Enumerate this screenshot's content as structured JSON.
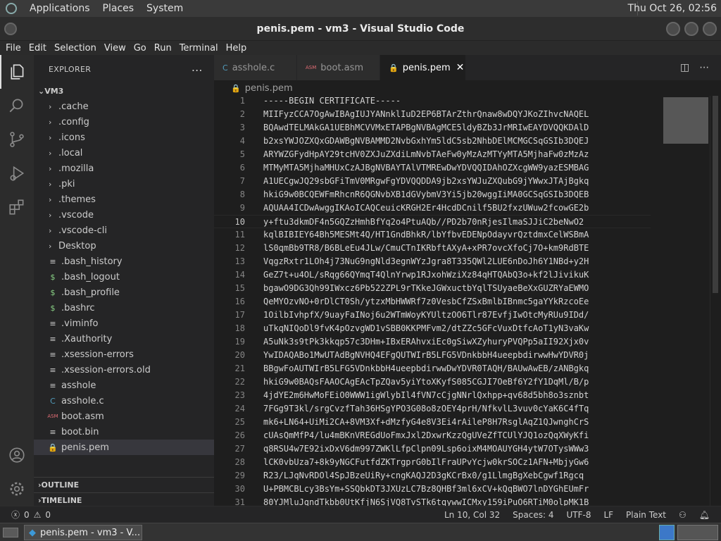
{
  "system_bar": {
    "menus": [
      "Applications",
      "Places",
      "System"
    ],
    "clock": "Thu Oct 26, 02:56"
  },
  "window": {
    "title": "penis.pem - vm3 - Visual Studio Code"
  },
  "menubar": [
    "File",
    "Edit",
    "Selection",
    "View",
    "Go",
    "Run",
    "Terminal",
    "Help"
  ],
  "activity_bar": {
    "top": [
      "explorer-icon",
      "search-icon",
      "source-control-icon",
      "run-debug-icon",
      "extensions-icon"
    ],
    "bottom": [
      "account-icon",
      "settings-gear-icon"
    ]
  },
  "explorer": {
    "title": "EXPLORER",
    "root": "VM3",
    "folders": [
      ".cache",
      ".config",
      ".icons",
      ".local",
      ".mozilla",
      ".pki",
      ".themes",
      ".vscode",
      ".vscode-cli",
      "Desktop"
    ],
    "files": [
      {
        "name": ".bash_history",
        "icon": "≡",
        "color": "#cccccc"
      },
      {
        "name": ".bash_logout",
        "icon": "$",
        "color": "#89d185"
      },
      {
        "name": ".bash_profile",
        "icon": "$",
        "color": "#89d185"
      },
      {
        "name": ".bashrc",
        "icon": "$",
        "color": "#89d185"
      },
      {
        "name": ".viminfo",
        "icon": "≡",
        "color": "#cccccc"
      },
      {
        "name": ".Xauthority",
        "icon": "≡",
        "color": "#cccccc"
      },
      {
        "name": ".xsession-errors",
        "icon": "≡",
        "color": "#cccccc"
      },
      {
        "name": ".xsession-errors.old",
        "icon": "≡",
        "color": "#cccccc"
      },
      {
        "name": "asshole",
        "icon": "≡",
        "color": "#cccccc"
      },
      {
        "name": "asshole.c",
        "icon": "C",
        "color": "#519aba"
      },
      {
        "name": "boot.asm",
        "icon": "ASM",
        "color": "#e06c75"
      },
      {
        "name": "boot.bin",
        "icon": "≡",
        "color": "#cccccc"
      },
      {
        "name": "penis.pem",
        "icon": "🔒",
        "color": "#e5c07b"
      }
    ],
    "selected": "penis.pem",
    "outline": "OUTLINE",
    "timeline": "TIMELINE"
  },
  "tabs": [
    {
      "label": "asshole.c",
      "icon": "C",
      "color": "#519aba",
      "active": false
    },
    {
      "label": "boot.asm",
      "icon": "ASM",
      "color": "#e06c75",
      "active": false
    },
    {
      "label": "penis.pem",
      "icon": "🔒",
      "color": "#e5c07b",
      "active": true
    }
  ],
  "breadcrumb": "penis.pem",
  "editor": {
    "current_line": 10,
    "lines": [
      "-----BEGIN CERTIFICATE-----",
      "MIIFyzCCA7OgAwIBAgIUJYANnklIuD2EP6BTArZthrQnaw8wDQYJKoZIhvcNAQEL",
      "BQAwdTELMAkGA1UEBhMCVVMxETAPBgNVBAgMCE5ldyBZb3JrMRIwEAYDVQQKDAlD",
      "b2xsYWJOZXQxGDAWBgNVBAMMD2NvbGxhYm5ldC5sb2NhbDElMCMGCSqGSIb3DQEJ",
      "ARYWZGFydHpAY29tcHV0ZXJuZXdiLmNvbTAeFw0yMzAzMTYyMTA5MjhaFw0zMzAz",
      "MTMyMTA5MjhaMHUxCzAJBgNVBAYTAlVTMREwDwYDVQQIDAhOZXcgWW9yazESMBAG",
      "A1UECgwJQ29sbGFiTmV0MRgwFgYDVQQDDA9jb2xsYWJuZXQubG9jYWwxJTAjBgkq",
      "hkiG9w0BCQEWFmRhcnR6QGNvbXB1dGVybmV3Yi5jb20wggIiMA0GCSqGSIb3DQEB",
      "AQUAA4ICDwAwggIKAoICAQCeuicKRGH2Er4HcdDCnilf5BU2fxzUWuw2fcowGE2b",
      "y+ftu3dkmDF4n5GQZzHmhBfYq2o4PtuAQb//PD2b70nRjesIlmaSJJiC2beNwO2",
      "kqlBIBIEY64Bh5MESMt4Q/HT1GndBhkR/lbYfbvEDENpOdayvrQztdmxCelWSBmA",
      "lS0qmBb9TR8/B6BLeEu4JLw/CmuCTnIKRbftAXyA+xPR7ovcXfoCj7O+km9RdBTE",
      "VqgzRxtr1LOh4j73NuG9ngNld3egnWYzJgra8T335QWl2LUE6nDoJh6Y1NBd+y2H",
      "GeZ7t+u4OL/sRqg66QYmqT4QlnYrwp1RJxohWziXz84qHTQAbQ3o+kf2lJivikuK",
      "bgawO9DG3Qh99IWxcz6Pb522ZPL9rTKkeJGWxuctbYqlTSUyaeBeXxGUZRYaEWMO",
      "QeMYOzvNO+0rDlCT0Sh/ytzxMbHWWRf7z0VesbCfZSxBmlbIBnmc5gaYYkRzcoEe",
      "1OilbIvhpfX/9uayFaINoj6u2WTmWoyKYUltzOO6Tlr87EvfjIwOtcMyRUu9IDd/",
      "uTkqNIQoDl9fvK4pOzvgWD1vSBB0KKPMFvm2/dtZZc5GFcVuxDtfcAoT1yN3vaKw",
      "A5uNk3s9tPk3kkqp57c3DHm+IBxERAhvxiEc0gSiwXZyhuryPVQPp5aII92Xjx0v",
      "YwIDAQABo1MwUTAdBgNVHQ4EFgQUTWIrB5LFG5VDnkbbH4ueepbdirwwHwYDVR0j",
      "BBgwFoAUTWIrB5LFG5VDnkbbH4ueepbdirwwDwYDVR0TAQH/BAUwAwEB/zANBgkq",
      "hkiG9w0BAQsFAAOCAgEAcTpZQav5yiYtoXKyfS085CGJI7OeBf6Y2fY1DqMl/B/p",
      "4jdYE2m6HwMoFEiO0WWW1igWlybIl4fVN7cCjgNNrlQxhpp+qv68d5bh8o3sznbt",
      "7FGg9T3kl/srgCvzfTah36HSgYPO3G08o8zOEY4prH/NfkvlL3vuv0cYaK6C4fTq",
      "mk6+LN64+UiMi2CA+8VM3Xf+dMzfyG4e8V3Ei4rAileP8H7RsglAqZ1QJwnghCrS",
      "cUAsQmMfP4/lu4mBKnVREGdUoFmxJxl2DxwrKzzQgUVeZfTCUlYJQ1ozQqXWyKfi",
      "q8RSU4w7E92ixDxV6dm997ZWKlLfpClpn09Lsp6oixM4MOAUYGH4ytW7OTysWWw3",
      "lCK0vbUza7+8k9yNGCFutfdZKTrgprG0bIlFraUPvYcjw0krSOCz1AFN+MbjyGw6",
      "R23/LJqNvRDOl4SpJBzeUiRy+cngKAQJ2D3gKCrBx0/g1LlmgBgXebCgwf1Rgcq",
      "U+PBMCBLcy3BsYm+SSQbkDT3JXUzLC7Bz8QHBf3ml6xCV+kQqBWO7lnDYGhEUmFr",
      "80YJMluJqndTkbb0UtKfjN6SjVQ8TvSTk6tqywwICMxy159iPuO6RTiM0olpMK1B"
    ]
  },
  "status": {
    "errors": "0",
    "warnings": "0",
    "position": "Ln 10, Col 32",
    "spaces": "Spaces: 4",
    "encoding": "UTF-8",
    "eol": "LF",
    "language": "Plain Text"
  },
  "taskbar": {
    "task_label": "penis.pem - vm3 - V..."
  }
}
